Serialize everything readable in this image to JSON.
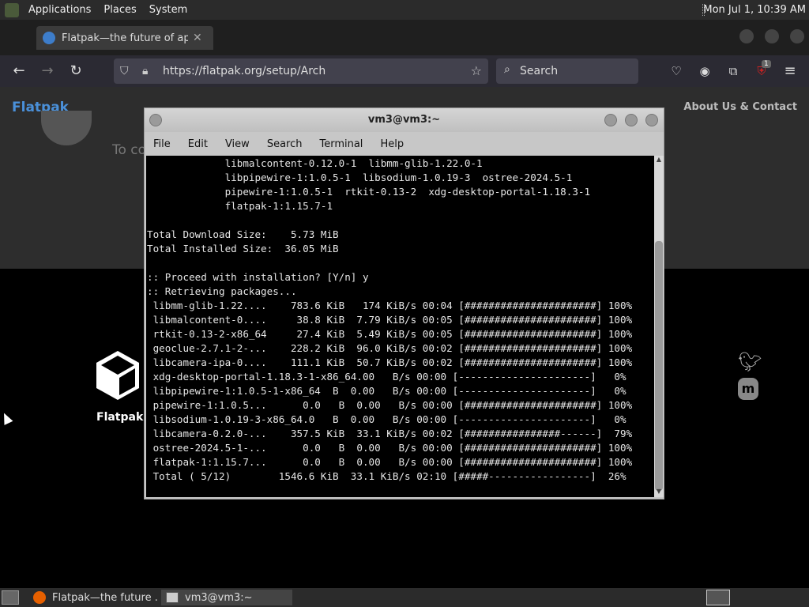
{
  "top_panel": {
    "menus": [
      "Applications",
      "Places",
      "System"
    ],
    "clock": "Mon Jul  1, 10:39 AM"
  },
  "browser": {
    "tab_title": "Flatpak—the future of appli",
    "tab_close": "✕",
    "url": "https://flatpak.org/setup/Arch",
    "search_placeholder": "Search",
    "extension_badge": "1"
  },
  "page": {
    "brand": "Flatpak",
    "about_link": "About Us & Contact",
    "partial_text": "To co",
    "footer_logo_label": "Flatpak"
  },
  "terminal": {
    "title": "vm3@vm3:~",
    "menu": [
      "File",
      "Edit",
      "View",
      "Search",
      "Terminal",
      "Help"
    ],
    "lines": [
      "             libmalcontent-0.12.0-1  libmm-glib-1.22.0-1",
      "             libpipewire-1:1.0.5-1  libsodium-1.0.19-3  ostree-2024.5-1",
      "             pipewire-1:1.0.5-1  rtkit-0.13-2  xdg-desktop-portal-1.18.3-1",
      "             flatpak-1:1.15.7-1",
      "",
      "Total Download Size:    5.73 MiB",
      "Total Installed Size:  36.05 MiB",
      "",
      ":: Proceed with installation? [Y/n] y",
      ":: Retrieving packages...",
      " libmm-glib-1.22....    783.6 KiB   174 KiB/s 00:04 [######################] 100%",
      " libmalcontent-0....     38.8 KiB  7.79 KiB/s 00:05 [######################] 100%",
      " rtkit-0.13-2-x86_64     27.4 KiB  5.49 KiB/s 00:05 [######################] 100%",
      " geoclue-2.7.1-2-...    228.2 KiB  96.0 KiB/s 00:02 [######################] 100%",
      " libcamera-ipa-0....    111.1 KiB  50.7 KiB/s 00:02 [######################] 100%",
      " xdg-desktop-portal-1.18.3-1-x86_64.00   B/s 00:00 [----------------------]   0%",
      " libpipewire-1:1.0.5-1-x86_64  B  0.00   B/s 00:00 [----------------------]   0%",
      " pipewire-1:1.0.5...      0.0   B  0.00   B/s 00:00 [######################] 100%",
      " libsodium-1.0.19-3-x86_64.0   B  0.00   B/s 00:00 [----------------------]   0%",
      " libcamera-0.2.0-...    357.5 KiB  33.1 KiB/s 00:02 [################------]  79%",
      " ostree-2024.5-1-...      0.0   B  0.00   B/s 00:00 [######################] 100%",
      " flatpak-1:1.15.7...      0.0   B  0.00   B/s 00:00 [######################] 100%",
      " Total ( 5/12)        1546.6 KiB  33.1 KiB/s 02:10 [#####-----------------]  26%"
    ]
  },
  "taskbar": {
    "tasks": [
      "Flatpak—the future ...",
      "vm3@vm3:~"
    ]
  }
}
